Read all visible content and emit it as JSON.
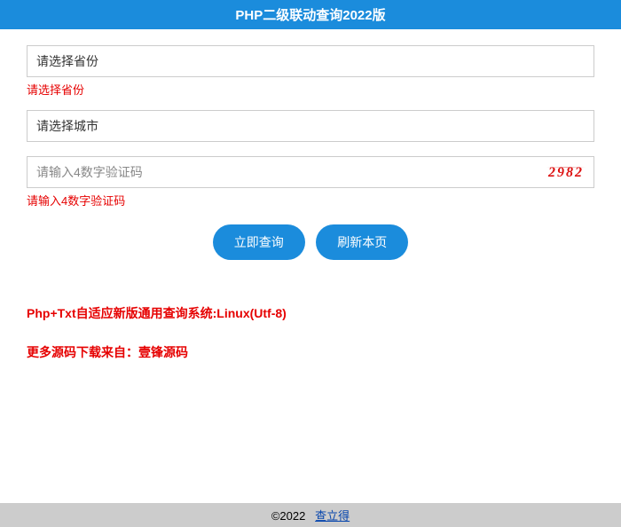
{
  "header": {
    "title": "PHP二级联动查询2022版"
  },
  "form": {
    "province": {
      "value": "请选择省份",
      "error": "请选择省份"
    },
    "city": {
      "value": "请选择城市"
    },
    "captcha": {
      "placeholder": "请输入4数字验证码",
      "error": "请输入4数字验证码",
      "code": "2982"
    },
    "buttons": {
      "query": "立即查询",
      "refresh": "刷新本页"
    }
  },
  "info": {
    "line1": "Php+Txt自适应新版通用查询系统:Linux(Utf-8)",
    "line2_prefix": "更多源码下载来自：",
    "line2_name": "壹锋源码"
  },
  "footer": {
    "copyright": "©2022",
    "link_text": "查立得"
  }
}
